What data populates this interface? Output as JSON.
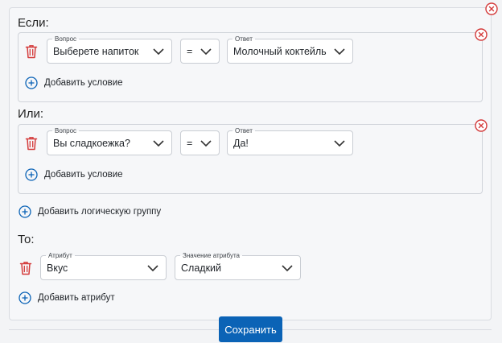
{
  "if_label": "Если:",
  "or_label": "Или:",
  "then_label": "То:",
  "groups": [
    {
      "question_legend": "Вопрос",
      "question_value": "Выберете напиток",
      "operator_value": "=",
      "answer_legend": "Ответ",
      "answer_value": "Молочный коктейль",
      "add_condition": "Добавить условие"
    },
    {
      "question_legend": "Вопрос",
      "question_value": "Вы сладкоежка?",
      "operator_value": "=",
      "answer_legend": "Ответ",
      "answer_value": "Да!",
      "add_condition": "Добавить условие"
    }
  ],
  "add_logic_group": "Добавить логическую группу",
  "attribute": {
    "attr_legend": "Атрибут",
    "attr_value": "Вкус",
    "attr_value_legend": "Значение атрибута",
    "attr_value_value": "Сладкий"
  },
  "add_attribute": "Добавить атрибут",
  "save_label": "Сохранить",
  "colors": {
    "accent": "#0b63b6",
    "danger": "#d43a3a",
    "border": "#c9cdd3"
  },
  "icons": [
    "trash-icon",
    "plus-circle-icon",
    "close-circle-icon",
    "chevron-down-icon"
  ]
}
